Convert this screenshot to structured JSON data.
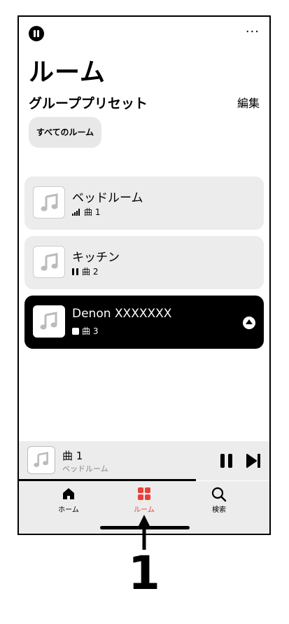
{
  "header": {
    "more_label": "···"
  },
  "page": {
    "title": "ルーム"
  },
  "presets": {
    "title": "グループプリセット",
    "edit_label": "編集",
    "chip_label": "すべてのルーム"
  },
  "rooms": [
    {
      "name": "ベッドルーム",
      "track": "曲 1",
      "status": "signal"
    },
    {
      "name": "キッチン",
      "track": "曲 2",
      "status": "paused"
    },
    {
      "name": "Denon XXXXXXX",
      "track": "曲 3",
      "status": "stopped",
      "selected": true
    }
  ],
  "mini_player": {
    "title": "曲 1",
    "subtitle": "ベッドルーム",
    "progress": 0.7
  },
  "tabs": [
    {
      "label": "ホーム",
      "icon": "home-icon"
    },
    {
      "label": "ルーム",
      "icon": "rooms-grid-icon",
      "active": true
    },
    {
      "label": "検索",
      "icon": "search-icon"
    }
  ],
  "callout": {
    "number": "1"
  },
  "colors": {
    "accent": "#e8413a",
    "card_bg": "#ececec",
    "selected_bg": "#000000"
  }
}
